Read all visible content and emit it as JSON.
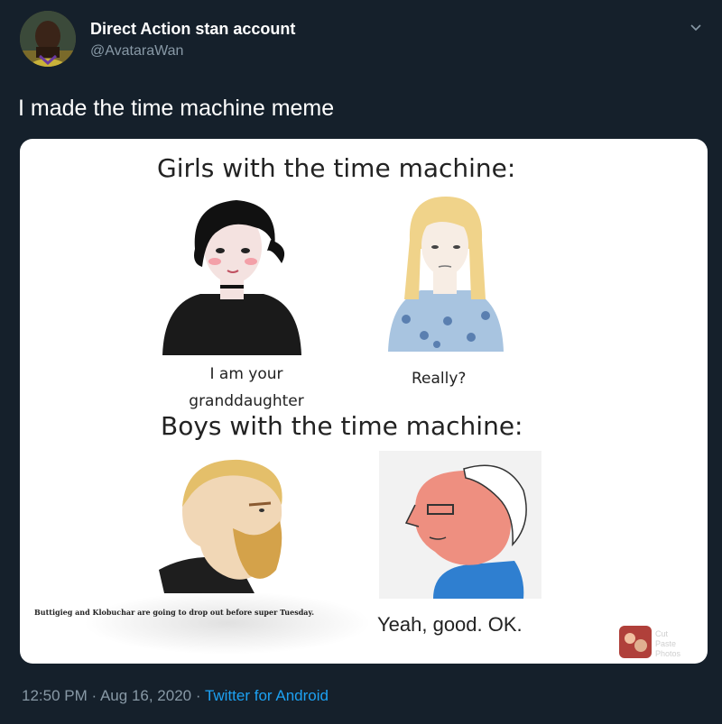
{
  "tweet": {
    "display_name": "Direct Action stan account",
    "handle": "@AvatarаWan",
    "text": "I made the time machine meme",
    "time": "12:50 PM",
    "separator": "·",
    "date": "Aug 16, 2020",
    "source": "Twitter for Android"
  },
  "meme": {
    "heading_girls": "Girls with the time machine:",
    "caption_girl_1": "I am your granddaughter",
    "caption_girl_2": "Really?",
    "heading_boys": "Boys with the time machine:",
    "caption_boy_1": "Buttigieg and Klobuchar are going to drop out before super Tuesday.",
    "caption_boy_2": "Yeah, good. OK.",
    "watermark": "Cut Paste Photos"
  },
  "colors": {
    "background": "#15202b",
    "secondary_text": "#8899a6",
    "link": "#1da1f2"
  },
  "icons": [
    "avatar",
    "chevron-down-icon"
  ]
}
